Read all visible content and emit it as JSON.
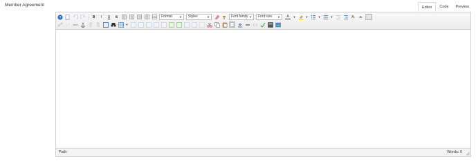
{
  "field": {
    "label": "Member Agreement"
  },
  "mode_tabs": [
    {
      "label": "Editor",
      "active": true
    },
    {
      "label": "Code",
      "active": false
    },
    {
      "label": "Preview",
      "active": false
    }
  ],
  "toolbar": {
    "bold": "B",
    "italic": "I",
    "underline": "U",
    "strike": "S",
    "format_select": "Format",
    "styles_select": "Styles",
    "font_family_select": "Font family",
    "font_size_select": "Font size",
    "text_color_glyph": "A",
    "superscript_glyph": "A",
    "subscript_glyph": "a"
  },
  "statusbar": {
    "path_label": "Path:",
    "word_count": "Words: 0"
  },
  "colors": {
    "text_color": "#1f3a8a",
    "highlight_color": "#f5e400",
    "border": "#cfcfcf",
    "toolbar_bg": "#efefef"
  }
}
